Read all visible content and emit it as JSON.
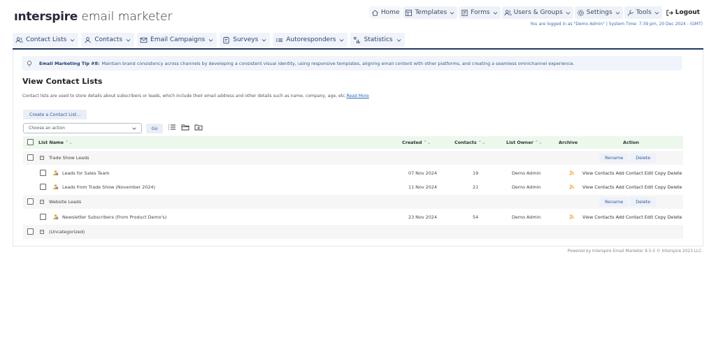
{
  "brand": {
    "bold": "ınterspire",
    "light": " email marketer"
  },
  "topnav": [
    {
      "label": "Home",
      "icon": "home-icon"
    },
    {
      "label": "Templates",
      "icon": "templates-icon",
      "dropdown": true
    },
    {
      "label": "Forms",
      "icon": "forms-icon",
      "dropdown": true
    },
    {
      "label": "Users & Groups",
      "icon": "users-icon",
      "dropdown": true
    },
    {
      "label": "Settings",
      "icon": "gear-icon",
      "dropdown": true
    },
    {
      "label": "Tools",
      "icon": "tools-icon",
      "dropdown": true
    },
    {
      "label": "Logout",
      "icon": "logout-icon"
    }
  ],
  "login_info": "You are logged in as \"Demo Admin\" | System Time: 7:39 pm, 20 Dec 2024 - (GMT)",
  "mainnav": [
    {
      "label": "Contact Lists",
      "icon": "contact-lists-icon"
    },
    {
      "label": "Contacts",
      "icon": "contacts-icon"
    },
    {
      "label": "Email Campaigns",
      "icon": "email-icon"
    },
    {
      "label": "Surveys",
      "icon": "surveys-icon"
    },
    {
      "label": "Autoresponders",
      "icon": "autoresponders-icon"
    },
    {
      "label": "Statistics",
      "icon": "statistics-icon"
    }
  ],
  "tip": {
    "title": "Email Marketing Tip #8:",
    "text": "Maintain brand consistency across channels by developing a consistent visual identity, using responsive templates, aligning email content with other platforms, and creating a seamless omnichannel experience."
  },
  "page": {
    "title": "View Contact Lists",
    "description": "Contact lists are used to store details about subscribers or leads, which include their email address and other details such as name, company, age, etc.",
    "read_more": "Read More",
    "create_button": "Create a Contact List...",
    "action_placeholder": "Choose an action",
    "go_button": "Go"
  },
  "table": {
    "headers": {
      "list_name": "List Name",
      "created": "Created",
      "contacts": "Contacts",
      "list_owner": "List Owner",
      "archive": "Archive",
      "action": "Action"
    },
    "sort_glyph": "⌃⌄",
    "group_actions": {
      "rename": "Rename",
      "delete": "Delete"
    },
    "row_actions": [
      "View Contacts",
      "Add Contact",
      "Edit",
      "Copy",
      "Delete"
    ],
    "groups": [
      {
        "name": "Trade Show Leads",
        "lists": [
          {
            "name": "Leads for Sales Team",
            "created": "07 Nov 2024",
            "contacts": "19",
            "owner": "Demo Admin"
          },
          {
            "name": "Leads from Trade Show (November 2024)",
            "created": "11 Nov 2024",
            "contacts": "21",
            "owner": "Demo Admin"
          }
        ]
      },
      {
        "name": "Website Leads",
        "lists": [
          {
            "name": "Newsletter Subscribers (From Product Demo's)",
            "created": "23 Nov 2024",
            "contacts": "54",
            "owner": "Demo Admin"
          }
        ]
      },
      {
        "name": "(Uncategorized)",
        "lists": []
      }
    ]
  },
  "footer": "Powered by Interspire Email Marketer 8.5.0 © Interspire 2023 LLC.",
  "colors": {
    "accent": "#1f3a5f",
    "link": "#2e6bbf",
    "header_row": "#ecf8ec",
    "rss": "#f08a00"
  }
}
